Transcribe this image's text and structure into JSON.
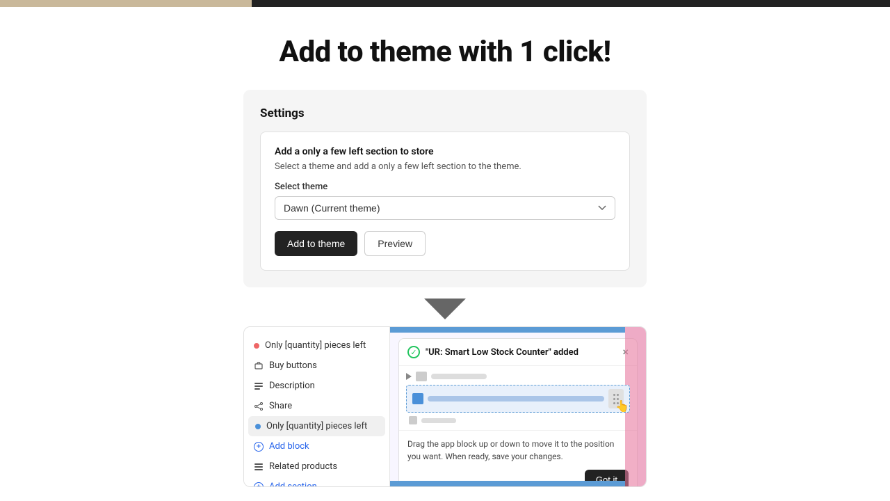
{
  "topBar": {
    "bgColor": "#222"
  },
  "heading": {
    "title": "Add to theme with 1 click!"
  },
  "settings": {
    "label": "Settings",
    "innerTitle": "Add a only a few left section to store",
    "innerDesc": "Select a theme and add a only a few left section to the theme.",
    "selectLabel": "Select theme",
    "selectOption": "Dawn (Current theme)",
    "addThemeLabel": "Add to theme",
    "previewLabel": "Preview"
  },
  "sidebar": {
    "items": [
      {
        "id": "only-qty-1",
        "label": "Only [quantity] pieces left",
        "type": "dot",
        "dotColor": "#e66",
        "active": false
      },
      {
        "id": "buy-buttons",
        "label": "Buy buttons",
        "type": "icon-cart",
        "active": false
      },
      {
        "id": "description",
        "label": "Description",
        "type": "icon-lines",
        "active": false
      },
      {
        "id": "share",
        "label": "Share",
        "type": "icon-share",
        "active": false
      },
      {
        "id": "only-qty-2",
        "label": "Only [quantity] pieces left",
        "type": "dot",
        "dotColor": "#4a90d9",
        "active": true
      },
      {
        "id": "add-block",
        "label": "Add block",
        "type": "add",
        "isLink": true
      },
      {
        "id": "related-products",
        "label": "Related products",
        "type": "icon-lines",
        "active": false
      },
      {
        "id": "add-section",
        "label": "Add section",
        "type": "add",
        "isLink": true
      }
    ]
  },
  "notification": {
    "title": "\"UR: Smart Low Stock Counter\" added",
    "closeLabel": "×",
    "description": "Drag the app block up or down to move it to the position you want. When ready, save your changes.",
    "gotItLabel": "Got it"
  }
}
